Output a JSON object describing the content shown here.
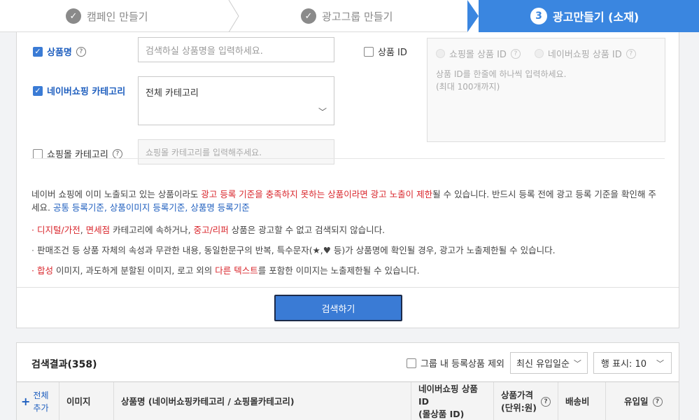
{
  "stepper": {
    "step1": "캠페인 만들기",
    "step2": "광고그룹 만들기",
    "step3_num": "3",
    "step3": "광고만들기 (소재)"
  },
  "form": {
    "product_name_label": "상품명",
    "product_name_placeholder": "검색하실 상품명을 입력하세요.",
    "naver_category_label": "네이버쇼핑 카테고리",
    "naver_category_value": "전체 카테고리",
    "mall_category_label": "쇼핑몰 카테고리",
    "mall_category_placeholder": "쇼핑몰 카테고리를 입력해주세요.",
    "product_id_label": "상품 ID",
    "mall_product_id_label": "쇼핑몰 상품 ID",
    "naver_product_id_label": "네이버쇼핑 상품 ID",
    "id_placeholder_line1": "상품 ID를 한줄에 하나씩 입력하세요.",
    "id_placeholder_line2": "(최대 100개까지)"
  },
  "notice": {
    "p1": "네이버 쇼핑에 이미 노출되고 있는 상품이라도 ",
    "p1_red1": "광고 등록 기준을 충족하지 못하는 상품이라면 광고 노출이 제한",
    "p2": "될 수 있습니다. 반드시 등록 전에 광고 등록 기준을 확인해 주세요. ",
    "link1": "공통 등록기준",
    "sep1": ", ",
    "link2": "상품이미지 등록기준",
    "sep2": ", ",
    "link3": "상품명 등록기준",
    "b1_red1": "디지털/가전",
    "b1_sep": ", ",
    "b1_red2": "면세점",
    "b1_mid": " 카테고리에 속하거나, ",
    "b1_red3": "중고/리퍼",
    "b1_end": " 상품은 광고할 수 없고 검색되지 않습니다.",
    "b2": "판매조건 등 상품 자체의 속성과 무관한 내용, 동일한문구의 반복, 특수문자(★,♥ 등)가 상품명에 확인될 경우, 광고가 노출제한될 수 있습니다.",
    "b3_red1": "합성",
    "b3_mid": " 이미지, 과도하게 분할된 이미지, 로고 외의 ",
    "b3_red2": "다른 텍스트",
    "b3_end": "를 포함한 이미지는 노출제한될 수 있습니다."
  },
  "search_button": "검색하기",
  "results": {
    "title": "검색결과(358)",
    "exclude_label": "그룹 내 등록상품 제외",
    "sort": "최신 유입일순",
    "rows": "행 표시: 10",
    "col_add_1": "전체",
    "col_add_2": "추가",
    "col_image": "이미지",
    "col_name": "상품명 (네이버쇼핑카테고리 / 쇼핑몰카테고리)",
    "col_id_1": "네이버쇼핑 상품 ID",
    "col_id_2": "(몰상품 ID)",
    "col_price_1": "상품가격",
    "col_price_2": "(단위:원)",
    "col_ship": "배송비",
    "col_date": "유입일"
  }
}
